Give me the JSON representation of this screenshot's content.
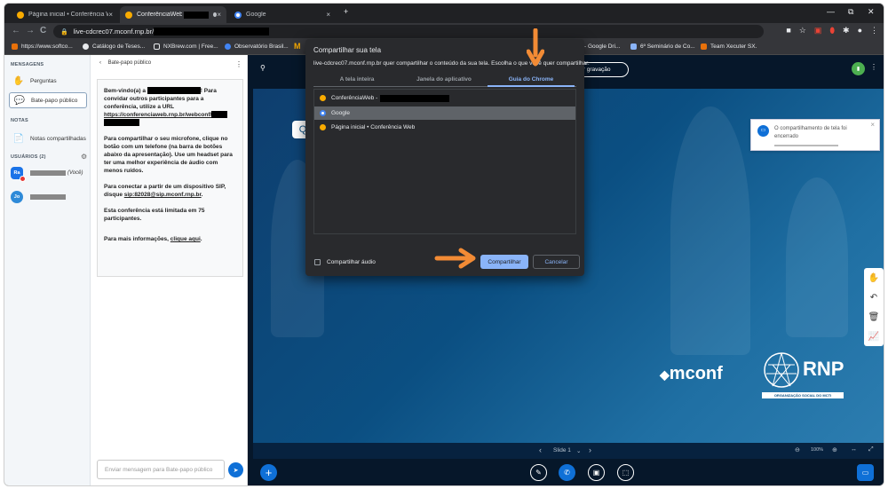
{
  "browser": {
    "tabs": [
      {
        "title": "Página inicial • Conferência Web",
        "close": "×"
      },
      {
        "title": "ConferênciaWeb -",
        "close": "×"
      },
      {
        "title": "Google",
        "close": "×"
      }
    ],
    "new_tab": "+",
    "window_controls": [
      "—",
      "⧉",
      "✕"
    ],
    "nav": {
      "back": "←",
      "forward": "→",
      "reload": "C"
    },
    "url": "live-cdcrec07.mconf.rnp.br/",
    "bookmarks": [
      "https://www.softco...",
      "Catálogo de Teses...",
      "NXBrew.com | Free...",
      "Observatório Brasil...",
      "- Google Dri...",
      "6º Seminário de Co...",
      "Team Xecuter SX."
    ],
    "bookmark_m": "M"
  },
  "sidebar": {
    "messages_header": "MENSAGENS",
    "items": [
      {
        "label": "Perguntas",
        "icon": "hand-icon"
      },
      {
        "label": "Bate-papo público",
        "icon": "chat-icon"
      }
    ],
    "notes_header": "NOTAS",
    "notes_item": "Notas compartilhadas",
    "users_header": "USUÁRIOS (2)",
    "users": [
      {
        "initials": "Ra",
        "suffix": "(Você)",
        "color": "#1a73e8"
      },
      {
        "initials": "Jo",
        "suffix": "",
        "color": "#2e8ad8"
      }
    ]
  },
  "chat": {
    "back": "‹",
    "title": "Bate-papo público",
    "menu": "⋮",
    "welcome_prefix": "Bem-vindo(a) a",
    "welcome_suffix": "! Para convidar outros participantes para a conferência, utilize a URL",
    "url_prefix": "https://conferenciaweb.rnp.br/webconf/",
    "mic_text": "Para compartilhar o seu microfone, clique no botão com um telefone (na barra de botões abaixo da apresentação). Use um headset para ter uma melhor experiência de áudio com menos ruídos.",
    "sip_prefix": "Para conectar a partir de um dispositivo SIP, disque",
    "sip_value": "sip:82028@sip.mconf.rnp.br",
    "limit_text": "Esta conferência está limitada em 75 participantes.",
    "info_prefix": "Para mais informações,",
    "info_link": "clique aqui",
    "input_placeholder": "Enviar mensagem para Bate-papo público",
    "send": "➤"
  },
  "main": {
    "record_label": "iciar gravação",
    "toast": "O compartilhamento de tela foi encerrado",
    "toast_close": "×",
    "brand": "mconf",
    "rnp": "RNP",
    "rnp_sub": "ORGANIZAÇÃO SOCIAL DO MCTI",
    "slide_label": "Slide 1",
    "zoom": "100%",
    "user_icon": "👤"
  },
  "dialog": {
    "title": "Compartilhar sua tela",
    "subtitle": "live-cdcrec07.mconf.rnp.br quer compartilhar o conteúdo da sua tela. Escolha o que você quer compartilhar.",
    "tabs": [
      "A tela inteira",
      "Janela do aplicativo",
      "Guia do Chrome"
    ],
    "rows": [
      {
        "label": "ConferênciaWeb -",
        "color": "#f9ab00"
      },
      {
        "label": "Google",
        "color": "#ffffff"
      },
      {
        "label": "Página inicial • Conferência Web",
        "color": "#f9ab00"
      }
    ],
    "audio_label": "Compartilhar áudio",
    "share_btn": "Compartilhar",
    "cancel_btn": "Cancelar"
  },
  "colors": {
    "accent": "#0f70d7",
    "arrow": "#f28b35",
    "dialog_blue": "#8ab4f8"
  }
}
